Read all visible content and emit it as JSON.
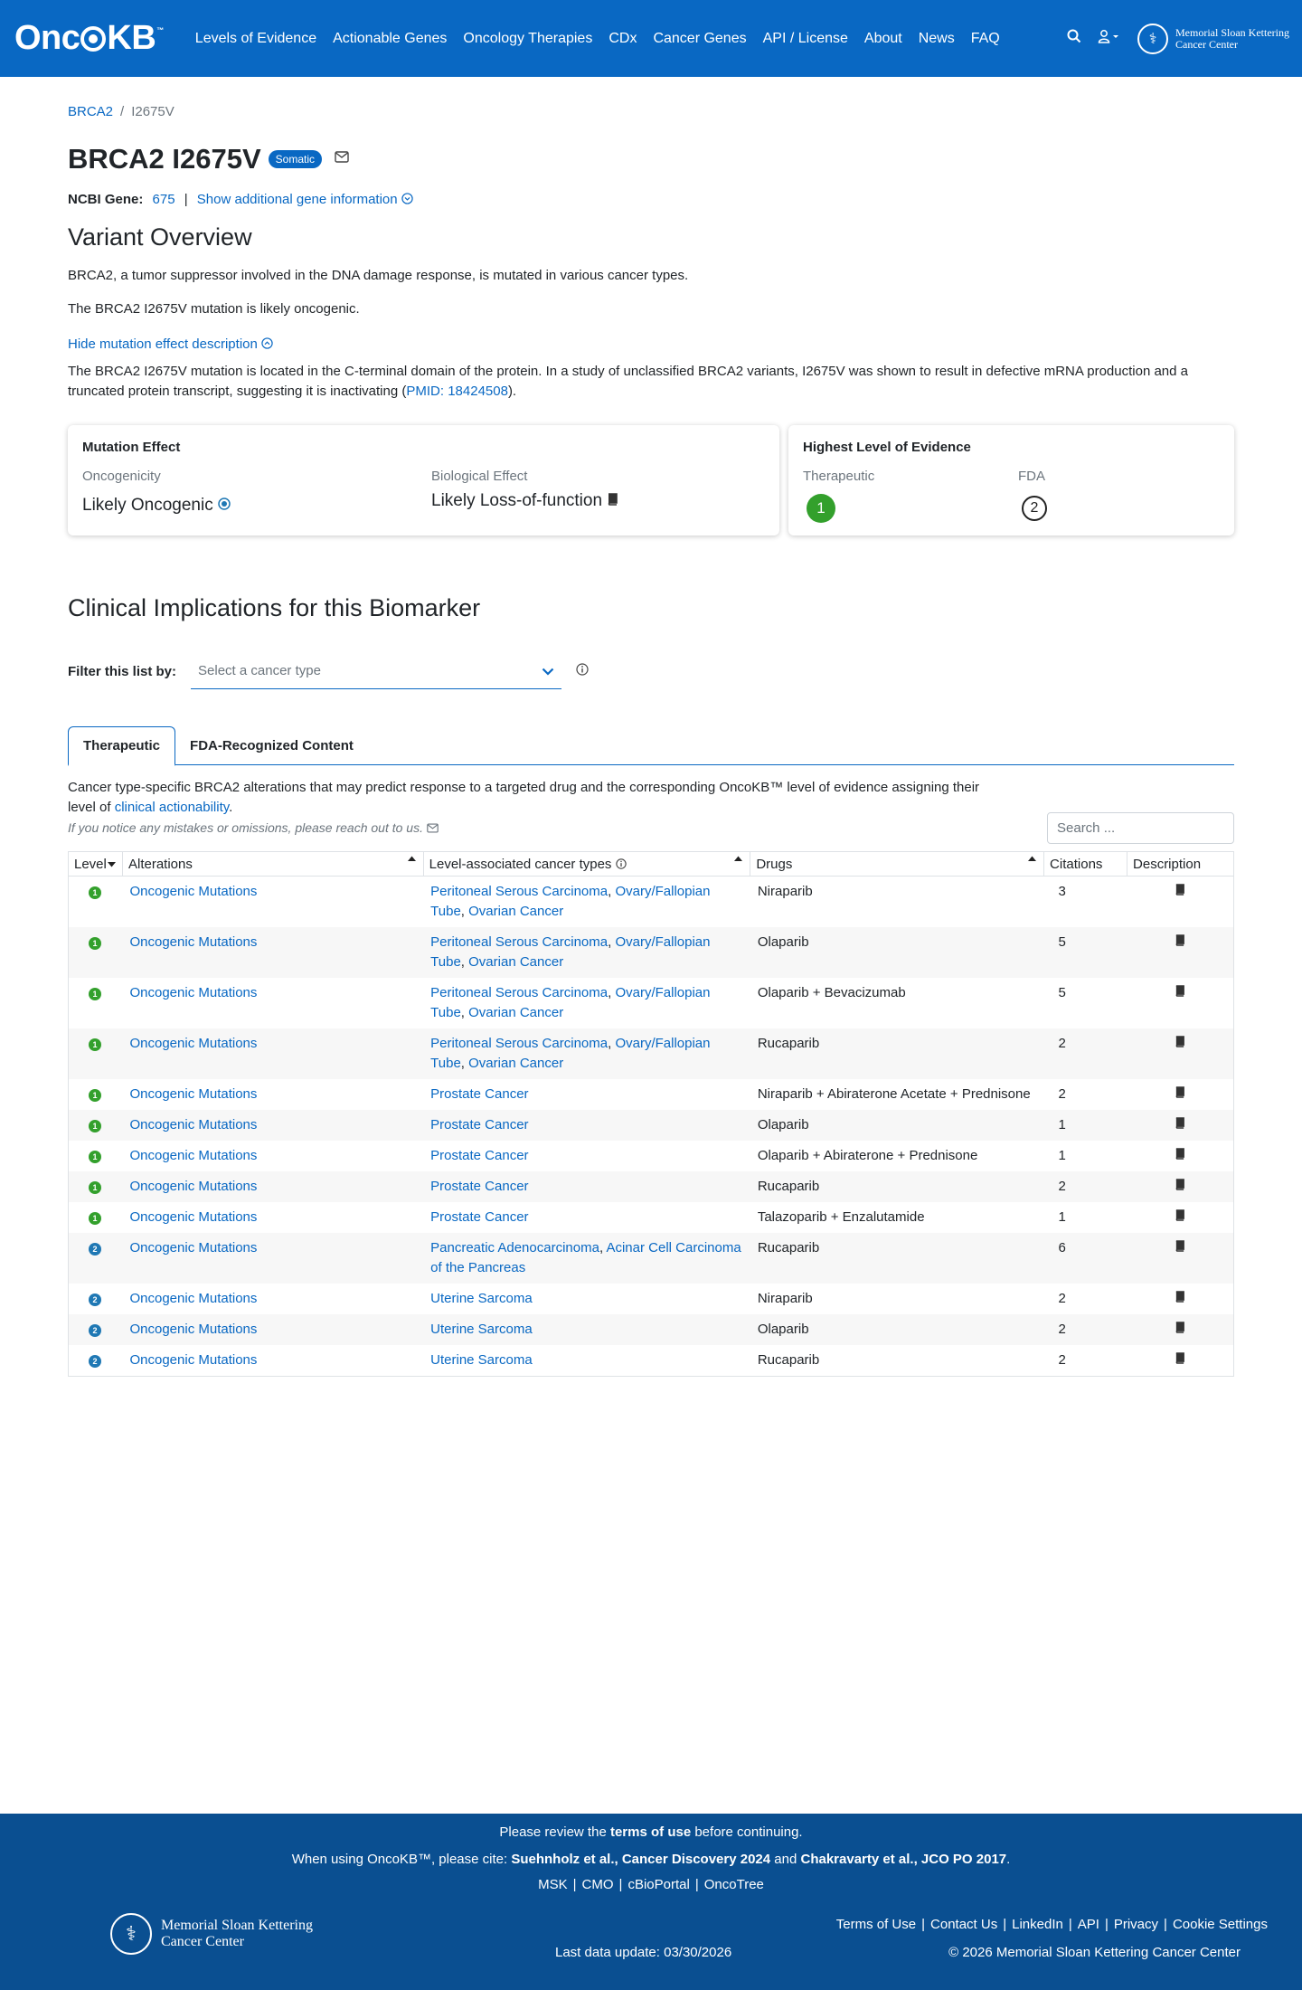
{
  "header": {
    "logo": "OncoKB",
    "logo_tm": "™",
    "nav": [
      "Levels of Evidence",
      "Actionable Genes",
      "Oncology Therapies",
      "CDx",
      "Cancer Genes",
      "API / License",
      "About",
      "News",
      "FAQ"
    ],
    "msk_line1": "Memorial Sloan Kettering",
    "msk_line2": "Cancer Center"
  },
  "breadcrumb": {
    "gene": "BRCA2",
    "separator": "/",
    "variant": "I2675V"
  },
  "title": {
    "text": "BRCA2 I2675V",
    "badge": "Somatic"
  },
  "ncbi": {
    "label": "NCBI Gene:",
    "id": "675",
    "sep": "|",
    "more": "Show additional gene information"
  },
  "overview": {
    "title": "Variant Overview",
    "p1": "BRCA2, a tumor suppressor involved in the DNA damage response, is mutated in various cancer types.",
    "p2": "The BRCA2 I2675V mutation is likely oncogenic.",
    "hide_link": "Hide mutation effect description",
    "p3": "The BRCA2 I2675V mutation is located in the C-terminal domain of the protein. In a study of unclassified BRCA2 variants, I2675V was shown to result in defective mRNA production and a truncated protein transcript, suggesting it is inactivating (",
    "p3_pmid": "PMID: 18424508",
    "p3_end": ")."
  },
  "mutation_effect": {
    "title": "Mutation Effect",
    "oncogenicity_label": "Oncogenicity",
    "oncogenicity_value": "Likely Oncogenic",
    "biological_label": "Biological Effect",
    "biological_value": "Likely Loss-of-function"
  },
  "highest_level": {
    "title": "Highest Level of Evidence",
    "therapeutic_label": "Therapeutic",
    "therapeutic_value": "1",
    "fda_label": "FDA",
    "fda_value": "2"
  },
  "clinical": {
    "title": "Clinical Implications for this Biomarker",
    "filter_label": "Filter this list by:",
    "filter_placeholder": "Select a cancer type",
    "tabs": [
      "Therapeutic",
      "FDA-Recognized Content"
    ],
    "desc1": "Cancer type-specific BRCA2 alterations that may predict response to a targeted drug and the corresponding OncoKB™ level of evidence assigning their level of ",
    "desc_link": "clinical actionability",
    "desc2": ".",
    "reach": "If you notice any mistakes or omissions, please reach out to us.",
    "search_placeholder": "Search ..."
  },
  "table": {
    "columns": [
      "Level",
      "Alterations",
      "Level-associated cancer types",
      "Drugs",
      "Citations",
      "Description"
    ],
    "rows": [
      {
        "level": "1",
        "alteration": "Oncogenic Mutations",
        "cancers": [
          "Peritoneal Serous Carcinoma",
          "Ovary/Fallopian Tube",
          "Ovarian Cancer"
        ],
        "drugs": "Niraparib",
        "citations": "3"
      },
      {
        "level": "1",
        "alteration": "Oncogenic Mutations",
        "cancers": [
          "Peritoneal Serous Carcinoma",
          "Ovary/Fallopian Tube",
          "Ovarian Cancer"
        ],
        "drugs": "Olaparib",
        "citations": "5"
      },
      {
        "level": "1",
        "alteration": "Oncogenic Mutations",
        "cancers": [
          "Peritoneal Serous Carcinoma",
          "Ovary/Fallopian Tube",
          "Ovarian Cancer"
        ],
        "drugs": "Olaparib + Bevacizumab",
        "citations": "5"
      },
      {
        "level": "1",
        "alteration": "Oncogenic Mutations",
        "cancers": [
          "Peritoneal Serous Carcinoma",
          "Ovary/Fallopian Tube",
          "Ovarian Cancer"
        ],
        "drugs": "Rucaparib",
        "citations": "2"
      },
      {
        "level": "1",
        "alteration": "Oncogenic Mutations",
        "cancers": [
          "Prostate Cancer"
        ],
        "drugs": "Niraparib + Abiraterone Acetate + Prednisone",
        "citations": "2"
      },
      {
        "level": "1",
        "alteration": "Oncogenic Mutations",
        "cancers": [
          "Prostate Cancer"
        ],
        "drugs": "Olaparib",
        "citations": "1"
      },
      {
        "level": "1",
        "alteration": "Oncogenic Mutations",
        "cancers": [
          "Prostate Cancer"
        ],
        "drugs": "Olaparib + Abiraterone + Prednisone",
        "citations": "1"
      },
      {
        "level": "1",
        "alteration": "Oncogenic Mutations",
        "cancers": [
          "Prostate Cancer"
        ],
        "drugs": "Rucaparib",
        "citations": "2"
      },
      {
        "level": "1",
        "alteration": "Oncogenic Mutations",
        "cancers": [
          "Prostate Cancer"
        ],
        "drugs": "Talazoparib + Enzalutamide",
        "citations": "1"
      },
      {
        "level": "2",
        "alteration": "Oncogenic Mutations",
        "cancers": [
          "Pancreatic Adenocarcinoma",
          "Acinar Cell Carcinoma of the Pancreas"
        ],
        "drugs": "Rucaparib",
        "citations": "6"
      },
      {
        "level": "2",
        "alteration": "Oncogenic Mutations",
        "cancers": [
          "Uterine Sarcoma"
        ],
        "drugs": "Niraparib",
        "citations": "2"
      },
      {
        "level": "2",
        "alteration": "Oncogenic Mutations",
        "cancers": [
          "Uterine Sarcoma"
        ],
        "drugs": "Olaparib",
        "citations": "2"
      },
      {
        "level": "2",
        "alteration": "Oncogenic Mutations",
        "cancers": [
          "Uterine Sarcoma"
        ],
        "drugs": "Rucaparib",
        "citations": "2"
      }
    ]
  },
  "footer": {
    "review_pre": "Please review the ",
    "review_link": "terms of use",
    "review_post": " before continuing.",
    "cite_pre": "When using OncoKB™, please cite: ",
    "cite1": "Suehnholz et al., Cancer Discovery 2024",
    "cite_and": " and ",
    "cite2": "Chakravarty et al., JCO PO 2017",
    "cite_end": ".",
    "links1": [
      "MSK",
      "CMO",
      "cBioPortal",
      "OncoTree"
    ],
    "links2": [
      "Terms of Use",
      "Contact Us",
      "LinkedIn",
      "API",
      "Privacy",
      "Cookie Settings"
    ],
    "last_update": "Last data update: 03/30/2026",
    "copyright": "© 2026 Memorial Sloan Kettering Cancer Center",
    "msk_line1": "Memorial Sloan Kettering",
    "msk_line2": "Cancer Center"
  },
  "colors": {
    "primary": "#0968c3",
    "footer": "#0a4f91",
    "level1": "#33a02c",
    "level2": "#1f78b4"
  }
}
